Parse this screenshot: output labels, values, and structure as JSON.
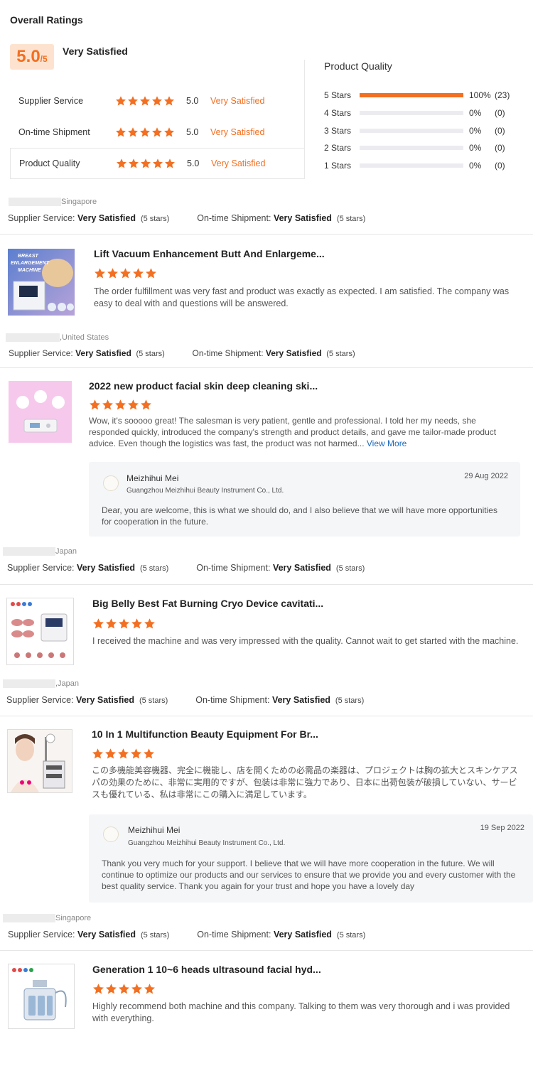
{
  "overall": {
    "title": "Overall Ratings",
    "score": "5.0",
    "out_of": "/5",
    "summary": "Very Satisfied",
    "categories": [
      {
        "label": "Supplier Service",
        "score": "5.0",
        "status": "Very Satisfied",
        "stars": 5
      },
      {
        "label": "On-time Shipment",
        "score": "5.0",
        "status": "Very Satisfied",
        "stars": 5
      },
      {
        "label": "Product Quality",
        "score": "5.0",
        "status": "Very Satisfied",
        "stars": 5
      }
    ],
    "product_quality": {
      "title": "Product Quality",
      "rows": [
        {
          "label": "5 Stars",
          "pct": "100%",
          "count": "(23)",
          "fill": 1.0
        },
        {
          "label": "4 Stars",
          "pct": "0%",
          "count": "(0)",
          "fill": 0
        },
        {
          "label": "3 Stars",
          "pct": "0%",
          "count": "(0)",
          "fill": 0
        },
        {
          "label": "2 Stars",
          "pct": "0%",
          "count": "(0)",
          "fill": 0
        },
        {
          "label": "1 Stars",
          "pct": "0%",
          "count": "(0)",
          "fill": 0
        }
      ]
    }
  },
  "meta_labels": {
    "supplier": "Supplier Service:",
    "shipment": "On-time Shipment:",
    "value": "Very Satisfied",
    "stars": "(5 stars)"
  },
  "reviews": [
    {
      "country": "Singapore",
      "product": "Lift Vacuum Enhancement Butt And Enlargeme...",
      "thumb_text": [
        "BREAST",
        "ENLARGEMENT",
        "MACHINE"
      ],
      "text": "The order fulfillment was very fast and product was exactly as expected. I am satisfied. The company was easy to deal with and questions will be answered.",
      "rating": 5
    },
    {
      "country": ",United States",
      "product": "2022 new product facial skin deep cleaning ski...",
      "text": "Wow, it's sooooo great! The salesman is very patient, gentle and professional. I told her my needs, she responded quickly, introduced the company's strength and product details, and gave me tailor-made product advice. Even though the logistics was fast, the product was not harmed...",
      "view_more": "View More",
      "rating": 5,
      "reply": {
        "name": "Meizhihui Mei",
        "company": "Guangzhou Meizhihui Beauty Instrument Co., Ltd.",
        "date": "29 Aug 2022",
        "text": "Dear, you are welcome, this is what we should do, and I also believe that we will have more opportunities for cooperation in the future."
      }
    },
    {
      "country": "Japan",
      "product": "Big Belly Best Fat Burning Cryo Device cavitati...",
      "text": "I received the machine and was very impressed with the quality. Cannot wait to get started with the machine.",
      "rating": 5
    },
    {
      "country": ",Japan",
      "product": "10 In 1 Multifunction Beauty Equipment For Br...",
      "text": "この多機能美容機器、完全に機能し、店を開くための必需品の楽器は、プロジェクトは胸の拡大とスキンケアスパの効果のために、非常に実用的ですが、包装は非常に強力であり、日本に出荷包装が破損していない、サービスも優れている、私は非常にこの購入に満足しています。",
      "rating": 5,
      "reply": {
        "name": "Meizhihui Mei",
        "company": "Guangzhou Meizhihui Beauty Instrument Co., Ltd.",
        "date": "19 Sep 2022",
        "text": "Thank you very much for your support. I believe that we will have more cooperation in the future. We will continue to optimize our products and our services to ensure that we provide you and every customer with the best quality service. Thank you again for your trust and hope you have a lovely day"
      }
    },
    {
      "country": "Singapore",
      "product": "Generation 1 10~6 heads ultrasound facial hyd...",
      "text": "Highly recommend both machine and this company. Talking to them was very thorough and i was provided with everything.",
      "rating": 5
    }
  ],
  "colors": {
    "accent": "#f36f21",
    "link": "#1a6bbd",
    "star": "#f36f21"
  }
}
